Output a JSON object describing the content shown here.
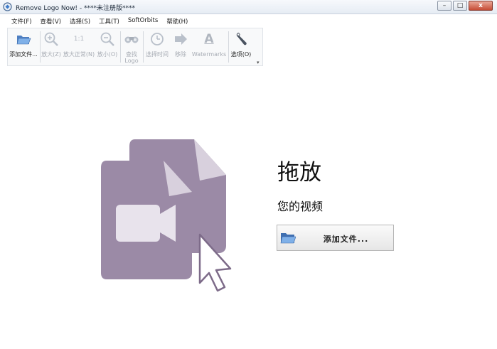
{
  "window": {
    "title": "Remove Logo Now! - ****未注册版****"
  },
  "menu": [
    {
      "label": "文件(F)"
    },
    {
      "label": "查看(V)"
    },
    {
      "label": "选择(S)"
    },
    {
      "label": "工具(T)"
    },
    {
      "label": "SoftOrbits"
    },
    {
      "label": "帮助(H)"
    }
  ],
  "toolbar": {
    "add_files": {
      "label": "添加文件...",
      "icon": "folder-open-icon"
    },
    "zoom_in": {
      "label": "放大(Z)",
      "icon": "zoom-in-icon"
    },
    "zoom_normal": {
      "label": "放大正常(N)",
      "icon_text": "1:1"
    },
    "zoom_out": {
      "label": "放小(O)",
      "icon": "zoom-out-icon"
    },
    "find_logo": {
      "label_line1": "查找",
      "label_line2": "Logo",
      "icon": "binoculars-icon"
    },
    "select_time": {
      "label": "选择时间",
      "icon": "clock-icon"
    },
    "remove": {
      "label": "移除",
      "icon": "arrow-right-icon"
    },
    "watermarks": {
      "label": "Watermarks",
      "icon_text": "A"
    },
    "options": {
      "label": "选项(O)",
      "icon": "wrench-icon"
    },
    "more_glyph": "▾"
  },
  "drop_area": {
    "title": "拖放",
    "subtitle": "您的视频",
    "button_label": "添加文件...",
    "accent_color": "#9b8aa6",
    "accent_dark": "#7d6b89"
  },
  "window_controls": {
    "minimize": "–",
    "maximize": "□",
    "close": "x"
  }
}
